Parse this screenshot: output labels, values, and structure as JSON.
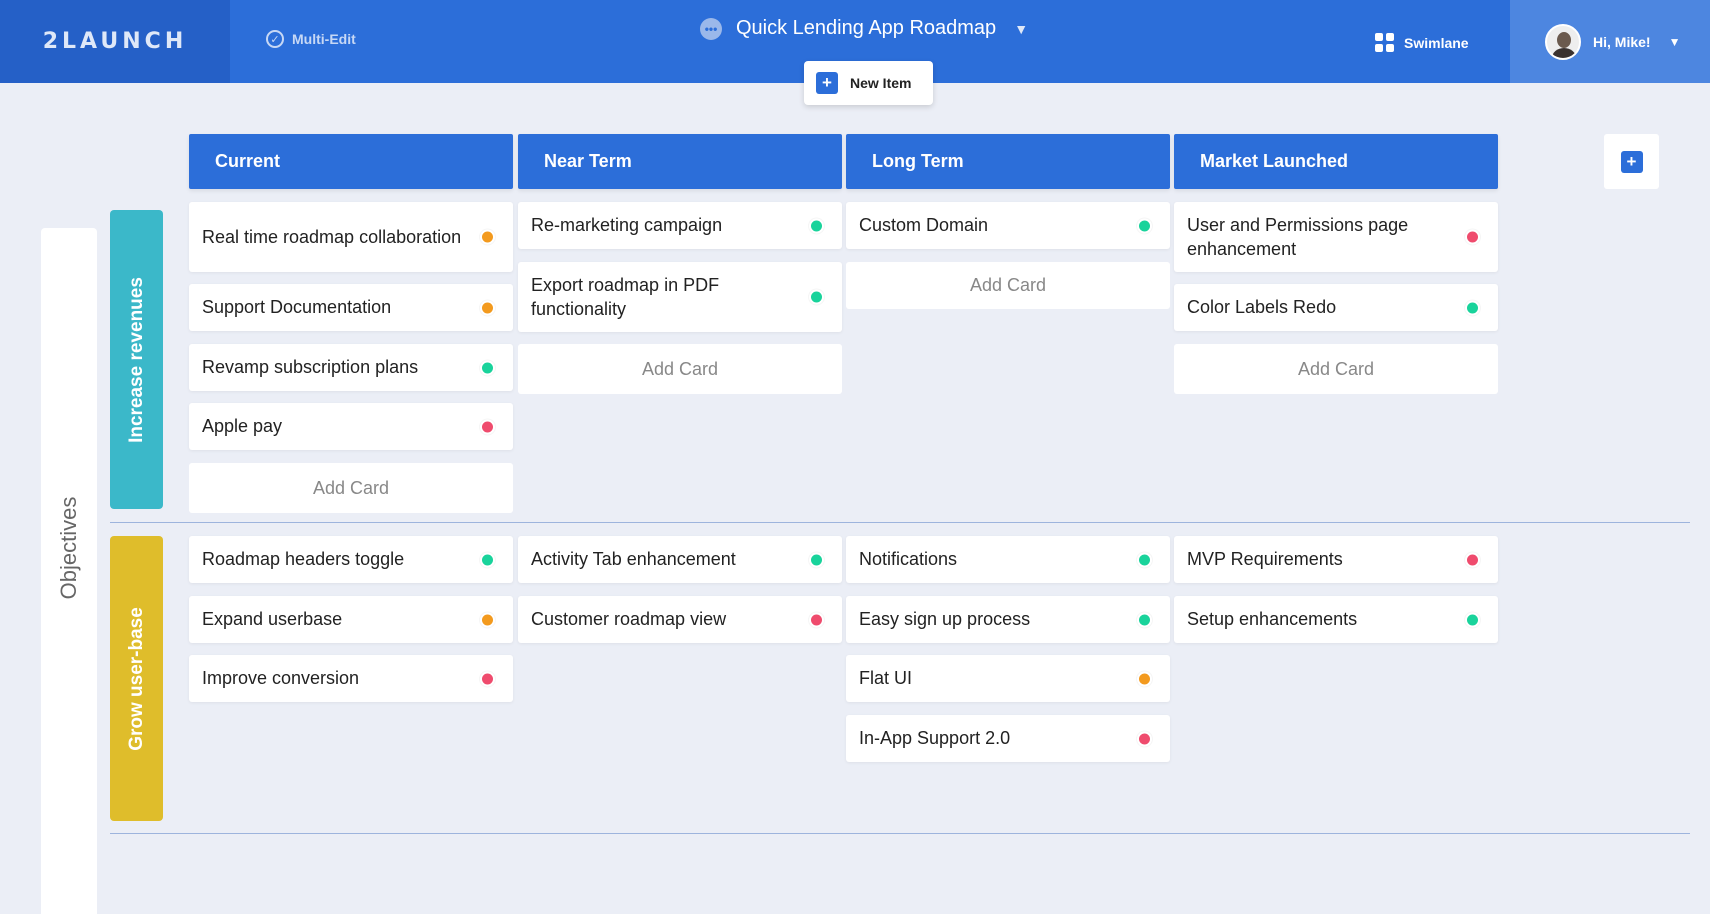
{
  "header": {
    "logo": "2LAUNCH",
    "multi_edit_label": "Multi-Edit",
    "project_title": "Quick Lending App Roadmap",
    "new_item_label": "New Item",
    "view_label": "Swimlane",
    "greeting": "Hi, Mike!"
  },
  "columns": [
    "Current",
    "Near Term",
    "Long Term",
    "Market Launched"
  ],
  "sidebar": {
    "objectives_label": "Objectives",
    "lanes": [
      {
        "label": "Increase revenues",
        "color": "#3bb8c9"
      },
      {
        "label": "Grow user-base",
        "color": "#dfbd2b"
      }
    ]
  },
  "add_card_label": "Add Card",
  "status_colors": {
    "orange": "#f39a1e",
    "green": "#19d39b",
    "red": "#ef4b6d"
  },
  "cards": {
    "lane1": {
      "current": [
        {
          "title": "Real time roadmap collaboration",
          "status": "orange"
        },
        {
          "title": "Support Documentation",
          "status": "orange"
        },
        {
          "title": "Revamp subscription plans",
          "status": "green"
        },
        {
          "title": "Apple pay",
          "status": "red"
        }
      ],
      "near_term": [
        {
          "title": "Re-marketing campaign",
          "status": "green"
        },
        {
          "title": "Export roadmap in PDF functionality",
          "status": "green"
        }
      ],
      "long_term": [
        {
          "title": "Custom Domain",
          "status": "green"
        }
      ],
      "market_launched": [
        {
          "title": "User and Permissions page enhancement",
          "status": "red"
        },
        {
          "title": "Color Labels Redo",
          "status": "green"
        }
      ]
    },
    "lane2": {
      "current": [
        {
          "title": "Roadmap headers toggle",
          "status": "green"
        },
        {
          "title": "Expand userbase",
          "status": "orange"
        },
        {
          "title": "Improve conversion",
          "status": "red"
        }
      ],
      "near_term": [
        {
          "title": "Activity Tab enhancement",
          "status": "green"
        },
        {
          "title": "Customer roadmap view",
          "status": "red"
        }
      ],
      "long_term": [
        {
          "title": "Notifications",
          "status": "green"
        },
        {
          "title": "Easy sign up process",
          "status": "green"
        },
        {
          "title": "Flat UI",
          "status": "orange"
        },
        {
          "title": "In-App Support 2.0",
          "status": "red"
        }
      ],
      "market_launched": [
        {
          "title": "MVP Requirements",
          "status": "red"
        },
        {
          "title": "Setup enhancements",
          "status": "green"
        }
      ]
    }
  }
}
